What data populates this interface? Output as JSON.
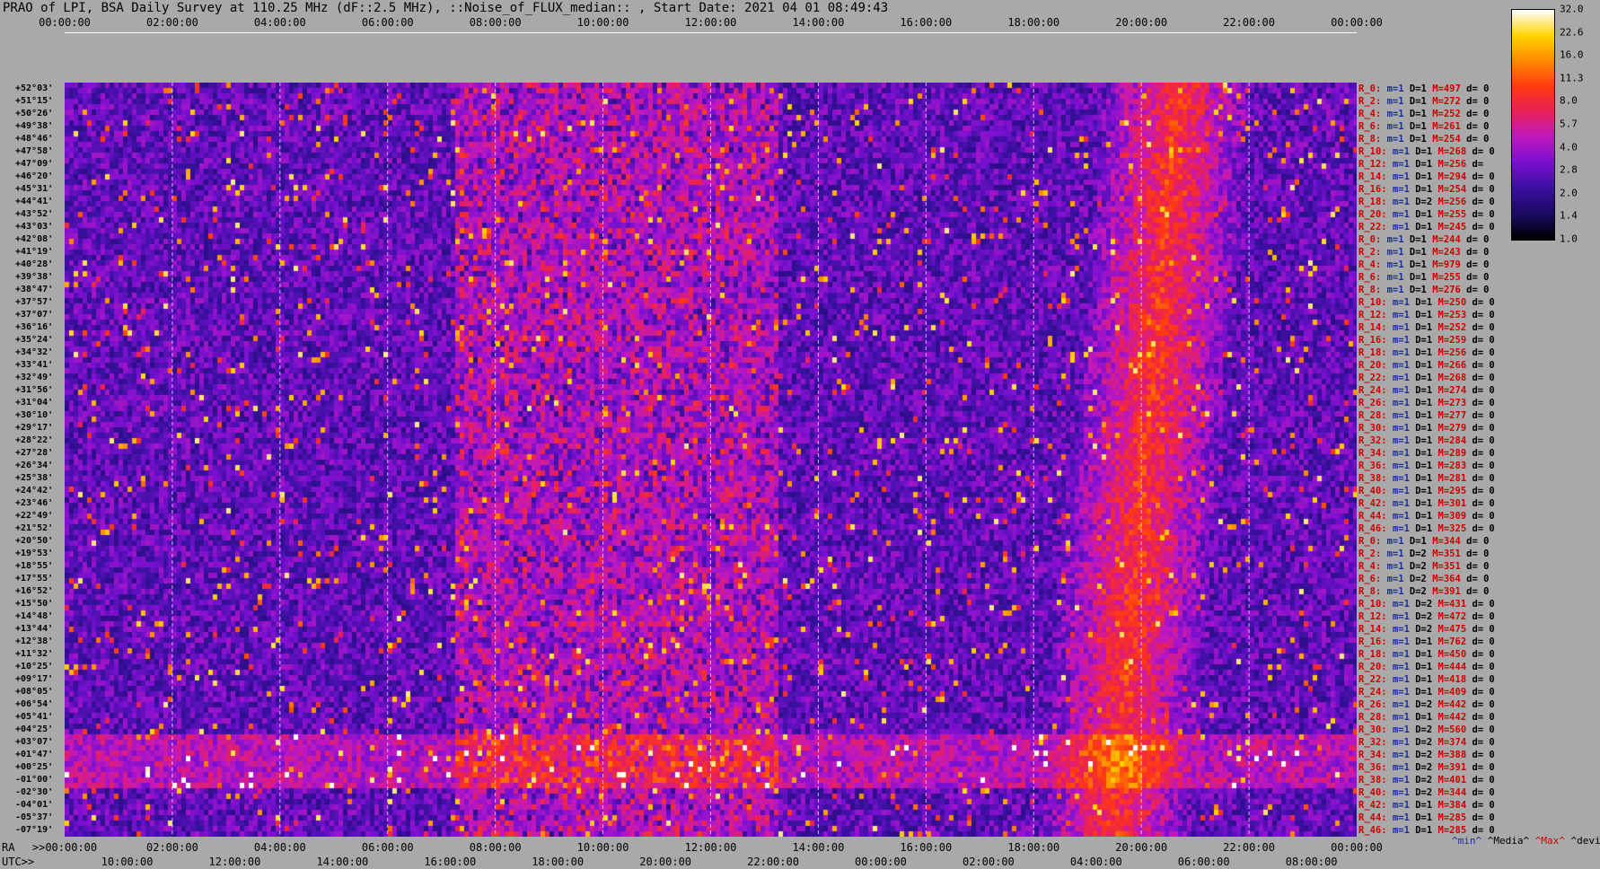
{
  "title": "PRAO of LPI, BSA Daily Survey at 110.25 MHz (dF::2.5 MHz), ::Noise_of_FLUX_median:: , Start Date: 2021 04 01 08:49:43",
  "chart_data": {
    "type": "heatmap",
    "title": "PRAO of LPI, BSA Daily Survey at 110.25 MHz (dF::2.5 MHz), ::Noise_of_FLUX_median:: , Start Date: 2021 04 01 08:49:43",
    "x_ticks_top": [
      "00:00:00",
      "02:00:00",
      "04:00:00",
      "06:00:00",
      "08:00:00",
      "10:00:00",
      "12:00:00",
      "14:00:00",
      "16:00:00",
      "18:00:00",
      "20:00:00",
      "22:00:00",
      "00:00:00"
    ],
    "x_ticks_ra": [
      ">>00:00:00",
      "02:00:00",
      "04:00:00",
      "06:00:00",
      "08:00:00",
      "10:00:00",
      "12:00:00",
      "14:00:00",
      "16:00:00",
      "18:00:00",
      "20:00:00",
      "22:00:00",
      "00:00:00"
    ],
    "x_ticks_utc": [
      "10:00:00",
      "12:00:00",
      "14:00:00",
      "16:00:00",
      "18:00:00",
      "20:00:00",
      "22:00:00",
      "00:00:00",
      "02:00:00",
      "04:00:00",
      "06:00:00",
      "08:00:00"
    ],
    "ra_label": "RA",
    "utc_label": "UTC>>",
    "declinations": [
      "+52°03'",
      "+51°15'",
      "+50°26'",
      "+49°38'",
      "+48°46'",
      "+47°58'",
      "+47°09'",
      "+46°20'",
      "+45°31'",
      "+44°41'",
      "+43°52'",
      "+43°03'",
      "+42°08'",
      "+41°19'",
      "+40°28'",
      "+39°38'",
      "+38°47'",
      "+37°57'",
      "+37°07'",
      "+36°16'",
      "+35°24'",
      "+34°32'",
      "+33°41'",
      "+32°49'",
      "+31°56'",
      "+31°04'",
      "+30°10'",
      "+29°17'",
      "+28°22'",
      "+27°28'",
      "+26°34'",
      "+25°38'",
      "+24°42'",
      "+23°46'",
      "+22°49'",
      "+21°52'",
      "+20°50'",
      "+19°53'",
      "+18°55'",
      "+17°55'",
      "+16°52'",
      "+15°50'",
      "+14°48'",
      "+13°44'",
      "+12°38'",
      "+11°32'",
      "+10°25'",
      "+09°17'",
      "+08°05'",
      "+06°54'",
      "+05°41'",
      "+04°25'",
      "+03°07'",
      "+01°47'",
      "+00°25'",
      "-01°00'",
      "-02°30'",
      "-04°01'",
      "-05°37'",
      "-07°19'"
    ],
    "row_stats": [
      {
        "label": "R_0:",
        "min": "m=1",
        "median": "D=1",
        "max": "M=497",
        "dev": "d= 0"
      },
      {
        "label": "R_2:",
        "min": "m=1",
        "median": "D=1",
        "max": "M=272",
        "dev": "d= 0"
      },
      {
        "label": "R_4:",
        "min": "m=1",
        "median": "D=1",
        "max": "M=252",
        "dev": "d= 0"
      },
      {
        "label": "R_6:",
        "min": "m=1",
        "median": "D=1",
        "max": "M=261",
        "dev": "d= 0"
      },
      {
        "label": "R_8:",
        "min": "m=1",
        "median": "D=1",
        "max": "M=254",
        "dev": "d= 0"
      },
      {
        "label": "R_10:",
        "min": "m=1",
        "median": "D=1",
        "max": "M=268",
        "dev": "d= 0"
      },
      {
        "label": "R_12:",
        "min": "m=1",
        "median": "D=1",
        "max": "M=256",
        "dev": "d="
      },
      {
        "label": "R_14:",
        "min": "m=1",
        "median": "D=1",
        "max": "M=294",
        "dev": "d= 0"
      },
      {
        "label": "R_16:",
        "min": "m=1",
        "median": "D=1",
        "max": "M=254",
        "dev": "d= 0"
      },
      {
        "label": "R_18:",
        "min": "m=1",
        "median": "D=2",
        "max": "M=256",
        "dev": "d= 0"
      },
      {
        "label": "R_20:",
        "min": "m=1",
        "median": "D=1",
        "max": "M=255",
        "dev": "d= 0"
      },
      {
        "label": "R_22:",
        "min": "m=1",
        "median": "D=1",
        "max": "M=245",
        "dev": "d= 0"
      },
      {
        "label": "R_0:",
        "min": "m=1",
        "median": "D=1",
        "max": "M=244",
        "dev": "d= 0"
      },
      {
        "label": "R_2:",
        "min": "m=1",
        "median": "D=1",
        "max": "M=243",
        "dev": "d= 0"
      },
      {
        "label": "R_4:",
        "min": "m=1",
        "median": "D=1",
        "max": "M=979",
        "dev": "d= 0"
      },
      {
        "label": "R_6:",
        "min": "m=1",
        "median": "D=1",
        "max": "M=255",
        "dev": "d= 0"
      },
      {
        "label": "R_8:",
        "min": "m=1",
        "median": "D=1",
        "max": "M=276",
        "dev": "d= 0"
      },
      {
        "label": "R_10:",
        "min": "m=1",
        "median": "D=1",
        "max": "M=250",
        "dev": "d= 0"
      },
      {
        "label": "R_12:",
        "min": "m=1",
        "median": "D=1",
        "max": "M=253",
        "dev": "d= 0"
      },
      {
        "label": "R_14:",
        "min": "m=1",
        "median": "D=1",
        "max": "M=252",
        "dev": "d= 0"
      },
      {
        "label": "R_16:",
        "min": "m=1",
        "median": "D=1",
        "max": "M=259",
        "dev": "d= 0"
      },
      {
        "label": "R_18:",
        "min": "m=1",
        "median": "D=1",
        "max": "M=256",
        "dev": "d= 0"
      },
      {
        "label": "R_20:",
        "min": "m=1",
        "median": "D=1",
        "max": "M=266",
        "dev": "d= 0"
      },
      {
        "label": "R_22:",
        "min": "m=1",
        "median": "D=1",
        "max": "M=268",
        "dev": "d= 0"
      },
      {
        "label": "R_24:",
        "min": "m=1",
        "median": "D=1",
        "max": "M=274",
        "dev": "d= 0"
      },
      {
        "label": "R_26:",
        "min": "m=1",
        "median": "D=1",
        "max": "M=273",
        "dev": "d= 0"
      },
      {
        "label": "R_28:",
        "min": "m=1",
        "median": "D=1",
        "max": "M=277",
        "dev": "d= 0"
      },
      {
        "label": "R_30:",
        "min": "m=1",
        "median": "D=1",
        "max": "M=279",
        "dev": "d= 0"
      },
      {
        "label": "R_32:",
        "min": "m=1",
        "median": "D=1",
        "max": "M=284",
        "dev": "d= 0"
      },
      {
        "label": "R_34:",
        "min": "m=1",
        "median": "D=1",
        "max": "M=289",
        "dev": "d= 0"
      },
      {
        "label": "R_36:",
        "min": "m=1",
        "median": "D=1",
        "max": "M=283",
        "dev": "d= 0"
      },
      {
        "label": "R_38:",
        "min": "m=1",
        "median": "D=1",
        "max": "M=281",
        "dev": "d= 0"
      },
      {
        "label": "R_40:",
        "min": "m=1",
        "median": "D=1",
        "max": "M=295",
        "dev": "d= 0"
      },
      {
        "label": "R_42:",
        "min": "m=1",
        "median": "D=1",
        "max": "M=301",
        "dev": "d= 0"
      },
      {
        "label": "R_44:",
        "min": "m=1",
        "median": "D=1",
        "max": "M=309",
        "dev": "d= 0"
      },
      {
        "label": "R_46:",
        "min": "m=1",
        "median": "D=1",
        "max": "M=325",
        "dev": "d= 0"
      },
      {
        "label": "R_0:",
        "min": "m=1",
        "median": "D=1",
        "max": "M=344",
        "dev": "d= 0"
      },
      {
        "label": "R_2:",
        "min": "m=1",
        "median": "D=2",
        "max": "M=351",
        "dev": "d= 0"
      },
      {
        "label": "R_4:",
        "min": "m=1",
        "median": "D=2",
        "max": "M=351",
        "dev": "d= 0"
      },
      {
        "label": "R_6:",
        "min": "m=1",
        "median": "D=2",
        "max": "M=364",
        "dev": "d= 0"
      },
      {
        "label": "R_8:",
        "min": "m=1",
        "median": "D=2",
        "max": "M=391",
        "dev": "d= 0"
      },
      {
        "label": "R_10:",
        "min": "m=1",
        "median": "D=2",
        "max": "M=431",
        "dev": "d= 0"
      },
      {
        "label": "R_12:",
        "min": "m=1",
        "median": "D=2",
        "max": "M=472",
        "dev": "d= 0"
      },
      {
        "label": "R_14:",
        "min": "m=1",
        "median": "D=2",
        "max": "M=475",
        "dev": "d= 0"
      },
      {
        "label": "R_16:",
        "min": "m=1",
        "median": "D=1",
        "max": "M=762",
        "dev": "d= 0"
      },
      {
        "label": "R_18:",
        "min": "m=1",
        "median": "D=1",
        "max": "M=450",
        "dev": "d= 0"
      },
      {
        "label": "R_20:",
        "min": "m=1",
        "median": "D=1",
        "max": "M=444",
        "dev": "d= 0"
      },
      {
        "label": "R_22:",
        "min": "m=1",
        "median": "D=1",
        "max": "M=418",
        "dev": "d= 0"
      },
      {
        "label": "R_24:",
        "min": "m=1",
        "median": "D=1",
        "max": "M=409",
        "dev": "d= 0"
      },
      {
        "label": "R_26:",
        "min": "m=1",
        "median": "D=2",
        "max": "M=442",
        "dev": "d= 0"
      },
      {
        "label": "R_28:",
        "min": "m=1",
        "median": "D=1",
        "max": "M=442",
        "dev": "d= 0"
      },
      {
        "label": "R_30:",
        "min": "m=1",
        "median": "D=2",
        "max": "M=560",
        "dev": "d= 0"
      },
      {
        "label": "R_32:",
        "min": "m=1",
        "median": "D=2",
        "max": "M=374",
        "dev": "d= 0"
      },
      {
        "label": "R_34:",
        "min": "m=1",
        "median": "D=2",
        "max": "M=388",
        "dev": "d= 0"
      },
      {
        "label": "R_36:",
        "min": "m=1",
        "median": "D=2",
        "max": "M=391",
        "dev": "d= 0"
      },
      {
        "label": "R_38:",
        "min": "m=1",
        "median": "D=2",
        "max": "M=401",
        "dev": "d= 0"
      },
      {
        "label": "R_40:",
        "min": "m=1",
        "median": "D=2",
        "max": "M=344",
        "dev": "d= 0"
      },
      {
        "label": "R_42:",
        "min": "m=1",
        "median": "D=1",
        "max": "M=384",
        "dev": "d= 0"
      },
      {
        "label": "R_44:",
        "min": "m=1",
        "median": "D=1",
        "max": "M=285",
        "dev": "d= 0"
      },
      {
        "label": "R_46:",
        "min": "m=1",
        "median": "D=1",
        "max": "M=285",
        "dev": "d= 0"
      }
    ],
    "legend": [
      "^min^",
      "^Media^",
      "^Max^",
      "^devia^"
    ],
    "colorbar": {
      "ticks": [
        "32.0",
        "22.6",
        "16.0",
        "11.3",
        "8.0",
        "5.7",
        "4.0",
        "2.8",
        "2.0",
        "1.4",
        "1.0"
      ],
      "range": [
        1.0,
        32.0
      ],
      "scale": "log",
      "colors": [
        "#000000",
        "#1a0a60",
        "#3a10a0",
        "#7a10d0",
        "#c018c0",
        "#e8205a",
        "#ff3a10",
        "#ff8a00",
        "#ffd400",
        "#ffffff"
      ]
    },
    "grid": true
  }
}
